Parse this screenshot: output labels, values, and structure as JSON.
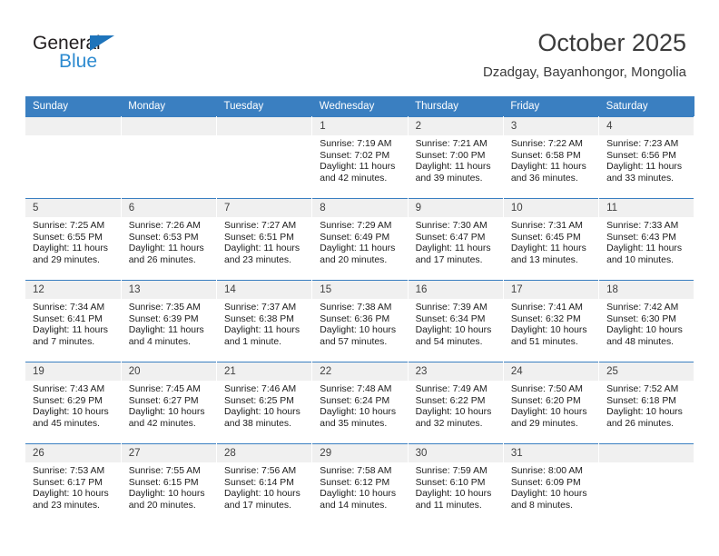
{
  "brand": {
    "name_top": "General",
    "name_bottom": "Blue",
    "color_dark": "#231f20",
    "color_blue": "#2e8bd0",
    "triangle_color": "#1e74bb"
  },
  "header": {
    "title": "October 2025",
    "subtitle": "Dzadgay, Bayanhongor, Mongolia"
  },
  "colors": {
    "header_row_bg": "#3a7fc1",
    "header_row_text": "#ffffff",
    "daynum_bg": "#f0f0f0",
    "cell_bg": "#ffffff",
    "text": "#1c1c1c"
  },
  "weekdays": [
    "Sunday",
    "Monday",
    "Tuesday",
    "Wednesday",
    "Thursday",
    "Friday",
    "Saturday"
  ],
  "weeks": [
    [
      {
        "day": "",
        "empty": true
      },
      {
        "day": "",
        "empty": true
      },
      {
        "day": "",
        "empty": true
      },
      {
        "day": "1",
        "sunrise": "Sunrise: 7:19 AM",
        "sunset": "Sunset: 7:02 PM",
        "daylight1": "Daylight: 11 hours",
        "daylight2": "and 42 minutes."
      },
      {
        "day": "2",
        "sunrise": "Sunrise: 7:21 AM",
        "sunset": "Sunset: 7:00 PM",
        "daylight1": "Daylight: 11 hours",
        "daylight2": "and 39 minutes."
      },
      {
        "day": "3",
        "sunrise": "Sunrise: 7:22 AM",
        "sunset": "Sunset: 6:58 PM",
        "daylight1": "Daylight: 11 hours",
        "daylight2": "and 36 minutes."
      },
      {
        "day": "4",
        "sunrise": "Sunrise: 7:23 AM",
        "sunset": "Sunset: 6:56 PM",
        "daylight1": "Daylight: 11 hours",
        "daylight2": "and 33 minutes."
      }
    ],
    [
      {
        "day": "5",
        "sunrise": "Sunrise: 7:25 AM",
        "sunset": "Sunset: 6:55 PM",
        "daylight1": "Daylight: 11 hours",
        "daylight2": "and 29 minutes."
      },
      {
        "day": "6",
        "sunrise": "Sunrise: 7:26 AM",
        "sunset": "Sunset: 6:53 PM",
        "daylight1": "Daylight: 11 hours",
        "daylight2": "and 26 minutes."
      },
      {
        "day": "7",
        "sunrise": "Sunrise: 7:27 AM",
        "sunset": "Sunset: 6:51 PM",
        "daylight1": "Daylight: 11 hours",
        "daylight2": "and 23 minutes."
      },
      {
        "day": "8",
        "sunrise": "Sunrise: 7:29 AM",
        "sunset": "Sunset: 6:49 PM",
        "daylight1": "Daylight: 11 hours",
        "daylight2": "and 20 minutes."
      },
      {
        "day": "9",
        "sunrise": "Sunrise: 7:30 AM",
        "sunset": "Sunset: 6:47 PM",
        "daylight1": "Daylight: 11 hours",
        "daylight2": "and 17 minutes."
      },
      {
        "day": "10",
        "sunrise": "Sunrise: 7:31 AM",
        "sunset": "Sunset: 6:45 PM",
        "daylight1": "Daylight: 11 hours",
        "daylight2": "and 13 minutes."
      },
      {
        "day": "11",
        "sunrise": "Sunrise: 7:33 AM",
        "sunset": "Sunset: 6:43 PM",
        "daylight1": "Daylight: 11 hours",
        "daylight2": "and 10 minutes."
      }
    ],
    [
      {
        "day": "12",
        "sunrise": "Sunrise: 7:34 AM",
        "sunset": "Sunset: 6:41 PM",
        "daylight1": "Daylight: 11 hours",
        "daylight2": "and 7 minutes."
      },
      {
        "day": "13",
        "sunrise": "Sunrise: 7:35 AM",
        "sunset": "Sunset: 6:39 PM",
        "daylight1": "Daylight: 11 hours",
        "daylight2": "and 4 minutes."
      },
      {
        "day": "14",
        "sunrise": "Sunrise: 7:37 AM",
        "sunset": "Sunset: 6:38 PM",
        "daylight1": "Daylight: 11 hours",
        "daylight2": "and 1 minute."
      },
      {
        "day": "15",
        "sunrise": "Sunrise: 7:38 AM",
        "sunset": "Sunset: 6:36 PM",
        "daylight1": "Daylight: 10 hours",
        "daylight2": "and 57 minutes."
      },
      {
        "day": "16",
        "sunrise": "Sunrise: 7:39 AM",
        "sunset": "Sunset: 6:34 PM",
        "daylight1": "Daylight: 10 hours",
        "daylight2": "and 54 minutes."
      },
      {
        "day": "17",
        "sunrise": "Sunrise: 7:41 AM",
        "sunset": "Sunset: 6:32 PM",
        "daylight1": "Daylight: 10 hours",
        "daylight2": "and 51 minutes."
      },
      {
        "day": "18",
        "sunrise": "Sunrise: 7:42 AM",
        "sunset": "Sunset: 6:30 PM",
        "daylight1": "Daylight: 10 hours",
        "daylight2": "and 48 minutes."
      }
    ],
    [
      {
        "day": "19",
        "sunrise": "Sunrise: 7:43 AM",
        "sunset": "Sunset: 6:29 PM",
        "daylight1": "Daylight: 10 hours",
        "daylight2": "and 45 minutes."
      },
      {
        "day": "20",
        "sunrise": "Sunrise: 7:45 AM",
        "sunset": "Sunset: 6:27 PM",
        "daylight1": "Daylight: 10 hours",
        "daylight2": "and 42 minutes."
      },
      {
        "day": "21",
        "sunrise": "Sunrise: 7:46 AM",
        "sunset": "Sunset: 6:25 PM",
        "daylight1": "Daylight: 10 hours",
        "daylight2": "and 38 minutes."
      },
      {
        "day": "22",
        "sunrise": "Sunrise: 7:48 AM",
        "sunset": "Sunset: 6:24 PM",
        "daylight1": "Daylight: 10 hours",
        "daylight2": "and 35 minutes."
      },
      {
        "day": "23",
        "sunrise": "Sunrise: 7:49 AM",
        "sunset": "Sunset: 6:22 PM",
        "daylight1": "Daylight: 10 hours",
        "daylight2": "and 32 minutes."
      },
      {
        "day": "24",
        "sunrise": "Sunrise: 7:50 AM",
        "sunset": "Sunset: 6:20 PM",
        "daylight1": "Daylight: 10 hours",
        "daylight2": "and 29 minutes."
      },
      {
        "day": "25",
        "sunrise": "Sunrise: 7:52 AM",
        "sunset": "Sunset: 6:18 PM",
        "daylight1": "Daylight: 10 hours",
        "daylight2": "and 26 minutes."
      }
    ],
    [
      {
        "day": "26",
        "sunrise": "Sunrise: 7:53 AM",
        "sunset": "Sunset: 6:17 PM",
        "daylight1": "Daylight: 10 hours",
        "daylight2": "and 23 minutes."
      },
      {
        "day": "27",
        "sunrise": "Sunrise: 7:55 AM",
        "sunset": "Sunset: 6:15 PM",
        "daylight1": "Daylight: 10 hours",
        "daylight2": "and 20 minutes."
      },
      {
        "day": "28",
        "sunrise": "Sunrise: 7:56 AM",
        "sunset": "Sunset: 6:14 PM",
        "daylight1": "Daylight: 10 hours",
        "daylight2": "and 17 minutes."
      },
      {
        "day": "29",
        "sunrise": "Sunrise: 7:58 AM",
        "sunset": "Sunset: 6:12 PM",
        "daylight1": "Daylight: 10 hours",
        "daylight2": "and 14 minutes."
      },
      {
        "day": "30",
        "sunrise": "Sunrise: 7:59 AM",
        "sunset": "Sunset: 6:10 PM",
        "daylight1": "Daylight: 10 hours",
        "daylight2": "and 11 minutes."
      },
      {
        "day": "31",
        "sunrise": "Sunrise: 8:00 AM",
        "sunset": "Sunset: 6:09 PM",
        "daylight1": "Daylight: 10 hours",
        "daylight2": "and 8 minutes."
      },
      {
        "day": "",
        "empty": true
      }
    ]
  ]
}
